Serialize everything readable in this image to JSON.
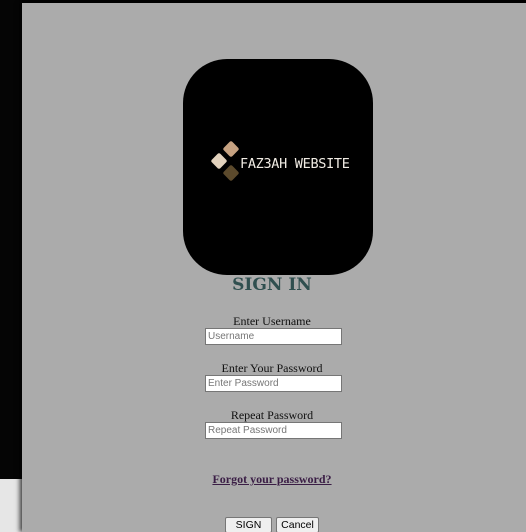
{
  "logo": {
    "text": "FAZ3AH WEBSITE",
    "colors": {
      "background": "#000000",
      "diamond_light": "#e2d2bd",
      "diamond_mid": "#c6a281",
      "diamond_dark": "#5c4a2c",
      "text": "#f1ece4"
    }
  },
  "form": {
    "title": "SIGN IN",
    "username": {
      "label": "Enter Username",
      "placeholder": "Username",
      "value": ""
    },
    "password": {
      "label": "Enter Your Password",
      "placeholder": "Enter Password",
      "value": ""
    },
    "repeat_password": {
      "label": "Repeat Password",
      "placeholder": "Repeat Password",
      "value": ""
    },
    "forgot_link": "Forgot your password?",
    "signin_button": "SIGN IN",
    "cancel_button": "Cancel"
  },
  "colors": {
    "panel_background": "#ababab",
    "title_color": "#2f4f4f",
    "link_color": "#3a1d45"
  }
}
